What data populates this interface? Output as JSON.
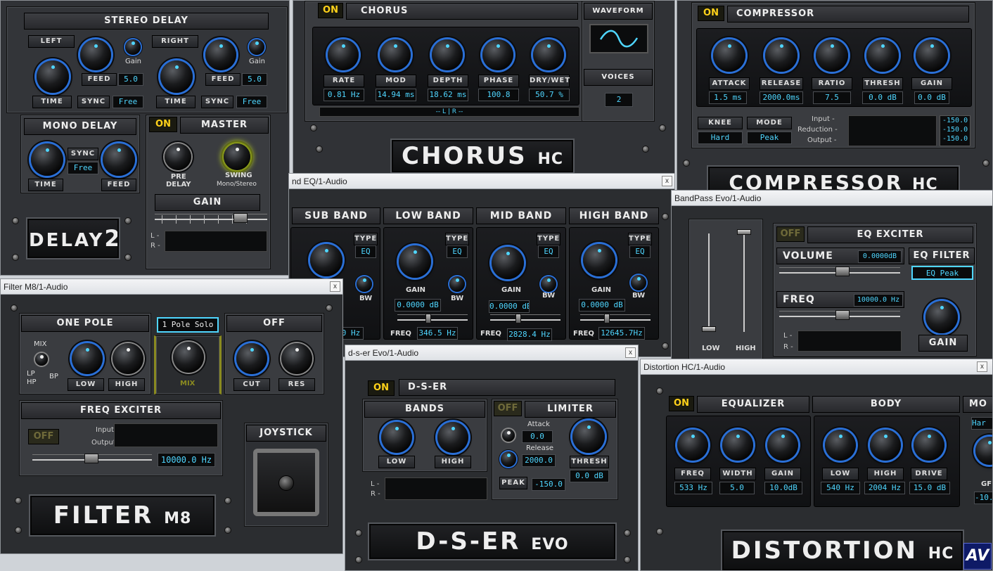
{
  "delay": {
    "title": "STEREO DELAY",
    "left": "LEFT",
    "right": "RIGHT",
    "gain": "Gain",
    "feed": "FEED",
    "feed_val": "5.0",
    "time": "TIME",
    "sync": "SYNC",
    "free": "Free",
    "mono_title": "MONO DELAY",
    "master": "MASTER",
    "on": "ON",
    "pre_delay": "PRE\nDELAY",
    "swing": "SWING",
    "swing_mode": "Mono/Stereo",
    "gain_label": "GAIN",
    "l": "L -",
    "r": "R -",
    "logo": "DELAY",
    "logo2": "2"
  },
  "chorus": {
    "on": "ON",
    "title": "CHORUS",
    "waveform": "WAVEFORM",
    "voices": "VOICES",
    "voices_val": "2",
    "labels": [
      "RATE",
      "MOD",
      "DEPTH",
      "PHASE",
      "DRY/WET"
    ],
    "values": [
      "0.81 Hz",
      "14.94 ms",
      "18.62 ms",
      "100.8",
      "50.7 %"
    ],
    "lr": "-- L | R --",
    "logo": "CHORUS",
    "logo2": "HC"
  },
  "compressor": {
    "on": "ON",
    "title": "COMPRESSOR",
    "labels": [
      "ATTACK",
      "RELEASE",
      "RATIO",
      "THRESH",
      "GAIN"
    ],
    "values": [
      "1.5 ms",
      "2000.0ms",
      "7.5",
      "0.0 dB",
      "0.0 dB"
    ],
    "knee": "KNEE",
    "knee_val": "Hard",
    "mode": "MODE",
    "mode_val": "Peak",
    "input": "Input -",
    "reduction": "Reduction -",
    "output": "Output -",
    "readout": "-150.0\n-150.0\n-150.0",
    "logo": "COMPRESSOR",
    "logo2": "HC"
  },
  "bandeq": {
    "title": "nd EQ/1-Audio",
    "close": "x",
    "bands": [
      "SUB BAND",
      "LOW BAND",
      "MID BAND",
      "HIGH BAND"
    ],
    "type": "TYPE",
    "eq": "EQ",
    "gain": "GAIN",
    "bw": "BW",
    "freq": "FREQ",
    "gains": [
      "0.0000 dB",
      "0.0000 dB",
      "0.0000 dB"
    ],
    "sub_freq": "0 Hz",
    "freqs": [
      "346.5 Hz",
      "2828.4 Hz",
      "12645.7Hz"
    ]
  },
  "bandpass": {
    "title": "BandPass Evo/1-Audio",
    "off": "OFF",
    "eq_exciter": "EQ EXCITER",
    "volume": "VOLUME",
    "volume_val": "0.0000dB",
    "eq_filter": "EQ FILTER",
    "eq_peak": "EQ Peak",
    "freq": "FREQ",
    "freq_val": "10000.0 Hz",
    "low": "LOW",
    "high": "HIGH",
    "gain": "GAIN",
    "l": "L -",
    "r": "R -"
  },
  "filter": {
    "title": "Filter M8/1-Audio",
    "close": "x",
    "one_pole": "ONE POLE",
    "pole_mode": "1 Pole Solo",
    "off_label": "OFF",
    "mix": "MIX",
    "lp": "LP",
    "hp": "HP",
    "bp": "BP",
    "low": "LOW",
    "high": "HIGH",
    "mix_label": "MIX",
    "cut": "CUT",
    "res": "RES",
    "freq_exciter": "FREQ EXCITER",
    "off": "OFF",
    "input": "Input",
    "output": "Output",
    "freq_val": "10000.0  Hz",
    "joystick": "JOYSTICK",
    "logo": "FILTER",
    "logo2": "M8"
  },
  "dser": {
    "title": "d-s-er Evo/1-Audio",
    "close": "x",
    "on": "ON",
    "name": "D-S-ER",
    "bands": "BANDS",
    "low": "LOW",
    "high": "HIGH",
    "off": "OFF",
    "limiter": "LIMITER",
    "attack": "Attack",
    "attack_val": "0.0",
    "release": "Release",
    "release_val": "2000.0",
    "thresh": "THRESH",
    "thresh_val": "0.0  dB",
    "peak": "PEAK",
    "peak_val": "-150.0",
    "l": "L -",
    "r": "R -",
    "logo": "D-S-ER",
    "logo2": "EVO"
  },
  "distortion": {
    "title": "Distortion HC/1-Audio",
    "close": "x",
    "on": "ON",
    "equalizer": "EQUALIZER",
    "body": "BODY",
    "mo": "MO",
    "har": "Har",
    "labels": [
      "FREQ",
      "WIDTH",
      "GAIN",
      "LOW",
      "HIGH",
      "DRIVE"
    ],
    "values": [
      "533  Hz",
      "5.0",
      "10.0dB",
      "540  Hz",
      "2004 Hz",
      "15.0 dB"
    ],
    "side_val": "-10.",
    "gl": "GF",
    "logo": "DISTORTION",
    "logo2": "HC"
  },
  "badge": {
    "text": "AV"
  },
  "colors": {
    "accent": "#2a6fd6",
    "value": "#4fd6ff",
    "on": "#ffd21a",
    "panel": "#2b2d30"
  }
}
